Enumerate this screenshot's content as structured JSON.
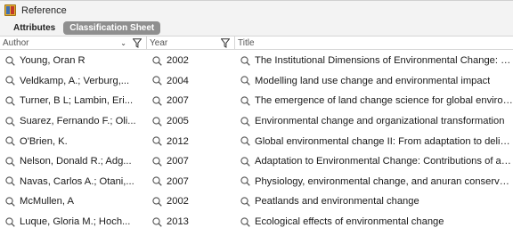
{
  "window": {
    "title": "Reference",
    "icon": "app-book-icon"
  },
  "tabs": [
    {
      "label": "Attributes",
      "active": false
    },
    {
      "label": "Classification Sheet",
      "active": true
    }
  ],
  "columns": {
    "author": "Author",
    "year": "Year",
    "title": "Title"
  },
  "rows": [
    {
      "author": "Young, Oran R",
      "year": "2002",
      "title": "The Institutional Dimensions of Environmental Change: Fit..."
    },
    {
      "author": "Veldkamp, A.; Verburg,...",
      "year": "2004",
      "title": "Modelling land use change and environmental impact"
    },
    {
      "author": "Turner, B L; Lambin, Eri...",
      "year": "2007",
      "title": "The emergence of land change science for global environ..."
    },
    {
      "author": "Suarez, Fernando F.; Oli...",
      "year": "2005",
      "title": "Environmental change and organizational transformation"
    },
    {
      "author": "O'Brien, K.",
      "year": "2012",
      "title": "Global environmental change II: From adaptation to delibe..."
    },
    {
      "author": "Nelson, Donald R.; Adg...",
      "year": "2007",
      "title": "Adaptation to Environmental Change: Contributions of a R..."
    },
    {
      "author": "Navas, Carlos A.; Otani,...",
      "year": "2007",
      "title": "Physiology, environmental change, and anuran conservati..."
    },
    {
      "author": "McMullen, A",
      "year": "2002",
      "title": "Peatlands and environmental change"
    },
    {
      "author": "Luque, Gloria M.; Hoch...",
      "year": "2013",
      "title": "Ecological effects of environmental change"
    }
  ]
}
